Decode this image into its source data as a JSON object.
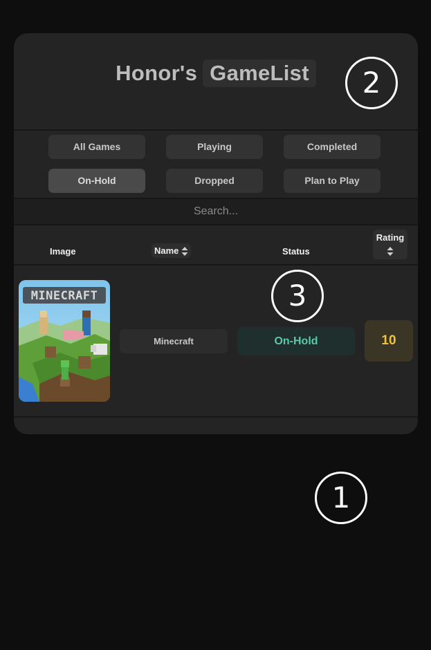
{
  "header": {
    "title_part_a": "Honor's",
    "title_part_b": "GameList"
  },
  "filters": [
    {
      "label": "All Games",
      "active": false
    },
    {
      "label": "Playing",
      "active": false
    },
    {
      "label": "Completed",
      "active": false
    },
    {
      "label": "On-Hold",
      "active": true
    },
    {
      "label": "Dropped",
      "active": false
    },
    {
      "label": "Plan to Play",
      "active": false
    }
  ],
  "search": {
    "placeholder": "Search...",
    "value": ""
  },
  "table": {
    "columns": {
      "image": "Image",
      "name": "Name",
      "status": "Status",
      "rating": "Rating"
    },
    "rows": [
      {
        "image_label": "MINECRAFT",
        "name": "Minecraft",
        "status": "On-Hold",
        "rating": "10"
      }
    ]
  },
  "markers": {
    "one": "1",
    "two": "2",
    "three": "3"
  },
  "colors": {
    "status_on_hold": "#5cc8a8",
    "rating": "#f0c43a"
  }
}
